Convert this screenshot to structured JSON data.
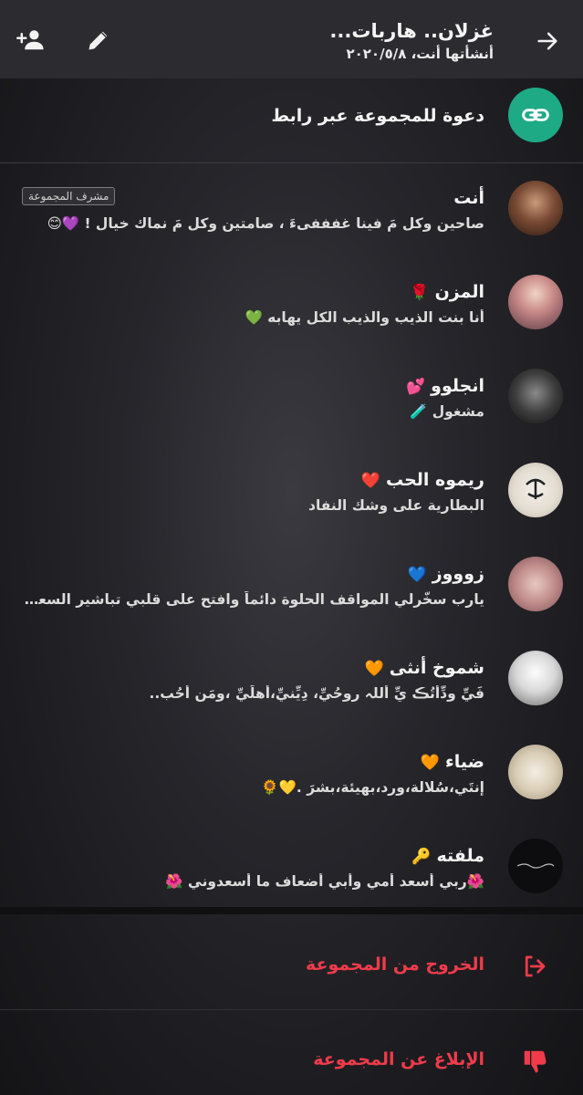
{
  "header": {
    "title": "غزلان.. هاربات...",
    "subtitle": "أنشأتها أنت، ٢٠٢٠/٥/٨"
  },
  "invite": {
    "label": "دعوة للمجموعة عبر رابط"
  },
  "admin_badge": "مشرف المجموعة",
  "members": [
    {
      "name": "أنت",
      "emoji": "",
      "status": "صاحين وكل مَ فينا غفففىءَ ، صامتين وكل مَ نماك خيال ! 💜😊"
    },
    {
      "name": "المزن",
      "emoji": "🌹",
      "status": "أنا بنت الذيب والذيب الكل يهابه 💚"
    },
    {
      "name": "انجلوو",
      "emoji": "💕",
      "status": "مشغول 🧪"
    },
    {
      "name": "ريموه الحب",
      "emoji": "❤️",
      "status": "البطارية على وشك النفاد"
    },
    {
      "name": "زوووز",
      "emoji": "💙",
      "status": "يارب سخّرلي المواقف الحلوة دائماً وافتح على قلبي تباشير السعادة..."
    },
    {
      "name": "شموخ أنثى",
      "emoji": "🧡",
      "status": "فَيِّ وِدِّأتُڪ يِّ أللہ روحُيِّ، دِيِّنيِّ،أهلَيِّ ،ومَن أحُب.."
    },
    {
      "name": "ضياء",
      "emoji": "🧡",
      "status": "إنتَي،سُلالة،ورد،بهيئة،بشرَ .💛🌻"
    },
    {
      "name": "ملفته",
      "emoji": "🔑",
      "status": "🌺ربي أسعد أمي وأبي أضعاف ما أسعدوني 🌺"
    }
  ],
  "actions": {
    "exit_label": "الخروج من المجموعة",
    "report_label": "الإبلاغ عن المجموعة"
  },
  "colors": {
    "accent_green": "#1faa86",
    "danger_red": "#ef3b4a",
    "header_bg": "#2b2b30"
  },
  "icons": {
    "back": "arrow-right-icon",
    "edit": "pencil-icon",
    "add_user": "add-person-icon",
    "invite": "link-icon",
    "exit": "logout-icon",
    "report": "thumbs-down-icon"
  }
}
